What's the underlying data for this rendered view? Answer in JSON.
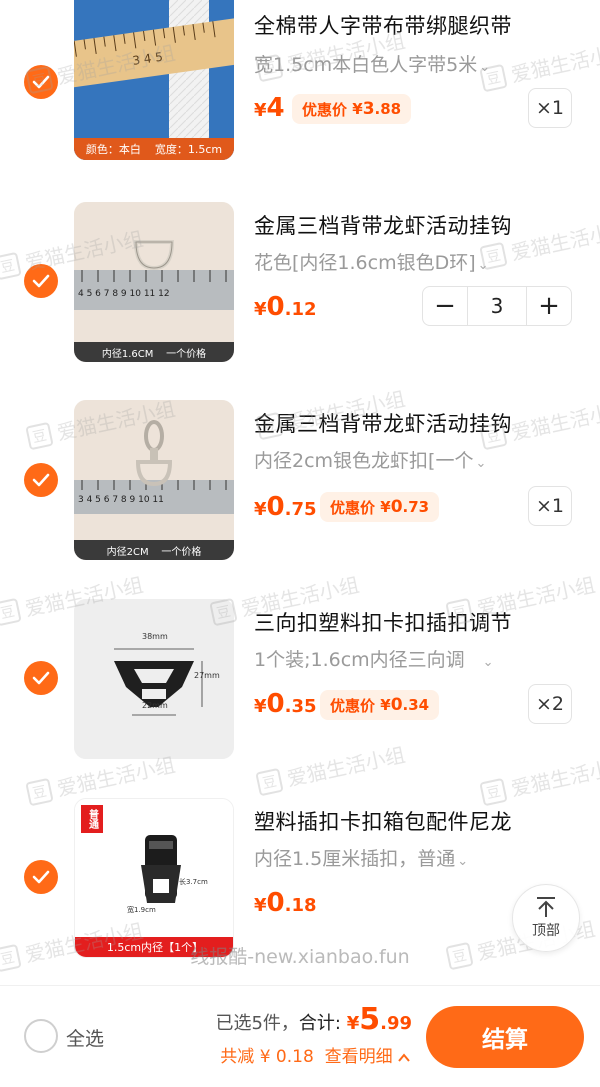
{
  "items": [
    {
      "title": "全棉带人字带布带绑腿织带",
      "sku": "宽1.5cm本白色人字带5米",
      "price_yen": "¥",
      "price_int": "4",
      "price_dec": "",
      "promo_label": "优惠价",
      "promo_yen": "¥",
      "promo_int": "3",
      "promo_dec": ".88",
      "qty": "×1",
      "thumb_caption": "颜色：本白    宽度：1.5cm",
      "checked": true
    },
    {
      "title": "金属三档背带龙虾活动挂钩",
      "sku": "花色[内径1.6cm银色D环]",
      "price_yen": "¥",
      "price_int": "0",
      "price_dec": ".12",
      "stepper": {
        "minus": "−",
        "value": "3",
        "plus": "+"
      },
      "thumb_caption": "内径1.6CM    一个价格",
      "checked": true
    },
    {
      "title": "金属三档背带龙虾活动挂钩",
      "sku": "内径2cm银色龙虾扣[一个",
      "price_yen": "¥",
      "price_int": "0",
      "price_dec": ".75",
      "promo_label": "优惠价",
      "promo_yen": "¥",
      "promo_int": "0",
      "promo_dec": ".73",
      "qty": "×1",
      "thumb_caption": "内径2CM    一个价格",
      "checked": true
    },
    {
      "title": "三向扣塑料扣卡扣插扣调节",
      "sku": "1个装;1.6cm内径三向调",
      "price_yen": "¥",
      "price_int": "0",
      "price_dec": ".35",
      "promo_label": "优惠价",
      "promo_yen": "¥",
      "promo_int": "0",
      "promo_dec": ".34",
      "qty": "×2",
      "thumb_dims": {
        "w": "38mm",
        "h": "27mm",
        "b": "22mm"
      },
      "checked": true
    },
    {
      "title": "塑料插扣卡扣箱包配件尼龙",
      "sku": "内径1.5厘米插扣，普通",
      "price_yen": "¥",
      "price_int": "0",
      "price_dec": ".18",
      "thumb_badge": "普通",
      "thumb_caption": "1.5cm内径【1个】",
      "thumb_dims": {
        "h": "长3.7cm",
        "w": "宽1.9cm"
      },
      "checked": true
    }
  ],
  "watermark": {
    "logo": "豆",
    "text": "爱猫生活小组"
  },
  "back_to_top": {
    "label": "顶部"
  },
  "credit": "线报酷-new.xianbao.fun",
  "footer": {
    "select_all": "全选",
    "selected_count": "已选5件，",
    "total_label": "合计: ",
    "total_yen": "¥",
    "total_int": "5",
    "total_dec": ".99",
    "discount": "共减 ¥ 0.18",
    "details": "查看明细",
    "checkout": "结算"
  },
  "colors": {
    "accent": "#ff6a17",
    "price": "#ff4d00"
  }
}
